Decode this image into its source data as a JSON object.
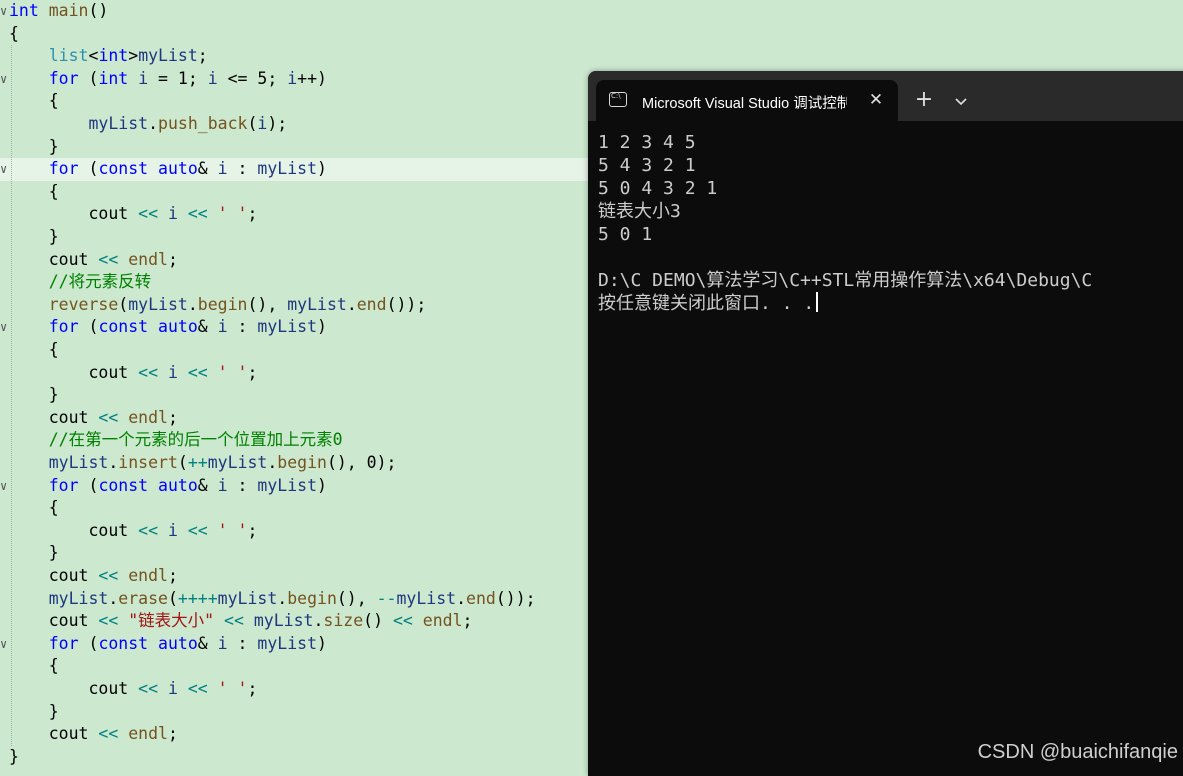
{
  "editor": {
    "lines": [
      {
        "fold": true,
        "hl": false,
        "tokens": [
          [
            "k",
            "int"
          ],
          [
            "p",
            " "
          ],
          [
            "f",
            "main"
          ],
          [
            "p",
            "()"
          ]
        ]
      },
      {
        "fold": false,
        "hl": false,
        "tokens": [
          [
            "p",
            "{"
          ]
        ]
      },
      {
        "fold": false,
        "hl": false,
        "tokens": [
          [
            "p",
            "    "
          ],
          [
            "t",
            "list"
          ],
          [
            "p",
            "<"
          ],
          [
            "k",
            "int"
          ],
          [
            "p",
            ">"
          ],
          [
            "v",
            "myList"
          ],
          [
            "p",
            ";"
          ]
        ]
      },
      {
        "fold": true,
        "hl": false,
        "tokens": [
          [
            "p",
            "    "
          ],
          [
            "k",
            "for"
          ],
          [
            "p",
            " ("
          ],
          [
            "k",
            "int"
          ],
          [
            "p",
            " "
          ],
          [
            "v",
            "i"
          ],
          [
            "p",
            " = 1; "
          ],
          [
            "v",
            "i"
          ],
          [
            "p",
            " <= 5; "
          ],
          [
            "v",
            "i"
          ],
          [
            "p",
            "++)"
          ]
        ]
      },
      {
        "fold": false,
        "hl": false,
        "tokens": [
          [
            "p",
            "    {"
          ]
        ]
      },
      {
        "fold": false,
        "hl": false,
        "tokens": [
          [
            "p",
            "        "
          ],
          [
            "v",
            "myList"
          ],
          [
            "p",
            "."
          ],
          [
            "f",
            "push_back"
          ],
          [
            "p",
            "("
          ],
          [
            "v",
            "i"
          ],
          [
            "p",
            ");"
          ]
        ]
      },
      {
        "fold": false,
        "hl": false,
        "tokens": [
          [
            "p",
            "    }"
          ]
        ]
      },
      {
        "fold": true,
        "hl": true,
        "tokens": [
          [
            "p",
            "    "
          ],
          [
            "k",
            "for"
          ],
          [
            "p",
            " ("
          ],
          [
            "k",
            "const"
          ],
          [
            "p",
            " "
          ],
          [
            "k",
            "auto"
          ],
          [
            "p",
            "& "
          ],
          [
            "v",
            "i"
          ],
          [
            "p",
            " : "
          ],
          [
            "v",
            "myList"
          ],
          [
            "p",
            ")"
          ]
        ]
      },
      {
        "fold": false,
        "hl": false,
        "tokens": [
          [
            "p",
            "    {"
          ]
        ]
      },
      {
        "fold": false,
        "hl": false,
        "tokens": [
          [
            "p",
            "        cout "
          ],
          [
            "o",
            "<<"
          ],
          [
            "p",
            " "
          ],
          [
            "v",
            "i"
          ],
          [
            "p",
            " "
          ],
          [
            "o",
            "<<"
          ],
          [
            "p",
            " "
          ],
          [
            "s",
            "' '"
          ],
          [
            "p",
            ";"
          ]
        ]
      },
      {
        "fold": false,
        "hl": false,
        "tokens": [
          [
            "p",
            "    }"
          ]
        ]
      },
      {
        "fold": false,
        "hl": false,
        "tokens": [
          [
            "p",
            "    cout "
          ],
          [
            "o",
            "<<"
          ],
          [
            "p",
            " "
          ],
          [
            "f",
            "endl"
          ],
          [
            "p",
            ";"
          ]
        ]
      },
      {
        "fold": false,
        "hl": false,
        "tokens": [
          [
            "p",
            "    "
          ],
          [
            "c",
            "//将元素反转"
          ]
        ]
      },
      {
        "fold": false,
        "hl": false,
        "tokens": [
          [
            "p",
            "    "
          ],
          [
            "f",
            "reverse"
          ],
          [
            "p",
            "("
          ],
          [
            "v",
            "myList"
          ],
          [
            "p",
            "."
          ],
          [
            "f",
            "begin"
          ],
          [
            "p",
            "(), "
          ],
          [
            "v",
            "myList"
          ],
          [
            "p",
            "."
          ],
          [
            "f",
            "end"
          ],
          [
            "p",
            "());"
          ]
        ]
      },
      {
        "fold": true,
        "hl": false,
        "tokens": [
          [
            "p",
            "    "
          ],
          [
            "k",
            "for"
          ],
          [
            "p",
            " ("
          ],
          [
            "k",
            "const"
          ],
          [
            "p",
            " "
          ],
          [
            "k",
            "auto"
          ],
          [
            "p",
            "& "
          ],
          [
            "v",
            "i"
          ],
          [
            "p",
            " : "
          ],
          [
            "v",
            "myList"
          ],
          [
            "p",
            ")"
          ]
        ]
      },
      {
        "fold": false,
        "hl": false,
        "tokens": [
          [
            "p",
            "    {"
          ]
        ]
      },
      {
        "fold": false,
        "hl": false,
        "tokens": [
          [
            "p",
            "        cout "
          ],
          [
            "o",
            "<<"
          ],
          [
            "p",
            " "
          ],
          [
            "v",
            "i"
          ],
          [
            "p",
            " "
          ],
          [
            "o",
            "<<"
          ],
          [
            "p",
            " "
          ],
          [
            "s",
            "' '"
          ],
          [
            "p",
            ";"
          ]
        ]
      },
      {
        "fold": false,
        "hl": false,
        "tokens": [
          [
            "p",
            "    }"
          ]
        ]
      },
      {
        "fold": false,
        "hl": false,
        "tokens": [
          [
            "p",
            "    cout "
          ],
          [
            "o",
            "<<"
          ],
          [
            "p",
            " "
          ],
          [
            "f",
            "endl"
          ],
          [
            "p",
            ";"
          ]
        ]
      },
      {
        "fold": false,
        "hl": false,
        "tokens": [
          [
            "p",
            "    "
          ],
          [
            "c",
            "//在第一个元素的后一个位置加上元素0"
          ]
        ]
      },
      {
        "fold": false,
        "hl": false,
        "tokens": [
          [
            "p",
            "    "
          ],
          [
            "v",
            "myList"
          ],
          [
            "p",
            "."
          ],
          [
            "f",
            "insert"
          ],
          [
            "p",
            "("
          ],
          [
            "o",
            "++"
          ],
          [
            "v",
            "myList"
          ],
          [
            "p",
            "."
          ],
          [
            "f",
            "begin"
          ],
          [
            "p",
            "(), 0);"
          ]
        ]
      },
      {
        "fold": true,
        "hl": false,
        "tokens": [
          [
            "p",
            "    "
          ],
          [
            "k",
            "for"
          ],
          [
            "p",
            " ("
          ],
          [
            "k",
            "const"
          ],
          [
            "p",
            " "
          ],
          [
            "k",
            "auto"
          ],
          [
            "p",
            "& "
          ],
          [
            "v",
            "i"
          ],
          [
            "p",
            " : "
          ],
          [
            "v",
            "myList"
          ],
          [
            "p",
            ")"
          ]
        ]
      },
      {
        "fold": false,
        "hl": false,
        "tokens": [
          [
            "p",
            "    {"
          ]
        ]
      },
      {
        "fold": false,
        "hl": false,
        "tokens": [
          [
            "p",
            "        cout "
          ],
          [
            "o",
            "<<"
          ],
          [
            "p",
            " "
          ],
          [
            "v",
            "i"
          ],
          [
            "p",
            " "
          ],
          [
            "o",
            "<<"
          ],
          [
            "p",
            " "
          ],
          [
            "s",
            "' '"
          ],
          [
            "p",
            ";"
          ]
        ]
      },
      {
        "fold": false,
        "hl": false,
        "tokens": [
          [
            "p",
            "    }"
          ]
        ]
      },
      {
        "fold": false,
        "hl": false,
        "tokens": [
          [
            "p",
            "    cout "
          ],
          [
            "o",
            "<<"
          ],
          [
            "p",
            " "
          ],
          [
            "f",
            "endl"
          ],
          [
            "p",
            ";"
          ]
        ]
      },
      {
        "fold": false,
        "hl": false,
        "tokens": [
          [
            "p",
            "    "
          ],
          [
            "v",
            "myList"
          ],
          [
            "p",
            "."
          ],
          [
            "f",
            "erase"
          ],
          [
            "p",
            "("
          ],
          [
            "o",
            "++++"
          ],
          [
            "v",
            "myList"
          ],
          [
            "p",
            "."
          ],
          [
            "f",
            "begin"
          ],
          [
            "p",
            "(), "
          ],
          [
            "o",
            "--"
          ],
          [
            "v",
            "myList"
          ],
          [
            "p",
            "."
          ],
          [
            "f",
            "end"
          ],
          [
            "p",
            "());"
          ]
        ]
      },
      {
        "fold": false,
        "hl": false,
        "tokens": [
          [
            "p",
            "    cout "
          ],
          [
            "o",
            "<<"
          ],
          [
            "p",
            " "
          ],
          [
            "s",
            "\"链表大小\""
          ],
          [
            "p",
            " "
          ],
          [
            "o",
            "<<"
          ],
          [
            "p",
            " "
          ],
          [
            "v",
            "myList"
          ],
          [
            "p",
            "."
          ],
          [
            "f",
            "size"
          ],
          [
            "p",
            "() "
          ],
          [
            "o",
            "<<"
          ],
          [
            "p",
            " "
          ],
          [
            "f",
            "endl"
          ],
          [
            "p",
            ";"
          ]
        ]
      },
      {
        "fold": true,
        "hl": false,
        "tokens": [
          [
            "p",
            "    "
          ],
          [
            "k",
            "for"
          ],
          [
            "p",
            " ("
          ],
          [
            "k",
            "const"
          ],
          [
            "p",
            " "
          ],
          [
            "k",
            "auto"
          ],
          [
            "p",
            "& "
          ],
          [
            "v",
            "i"
          ],
          [
            "p",
            " : "
          ],
          [
            "v",
            "myList"
          ],
          [
            "p",
            ")"
          ]
        ]
      },
      {
        "fold": false,
        "hl": false,
        "tokens": [
          [
            "p",
            "    {"
          ]
        ]
      },
      {
        "fold": false,
        "hl": false,
        "tokens": [
          [
            "p",
            "        cout "
          ],
          [
            "o",
            "<<"
          ],
          [
            "p",
            " "
          ],
          [
            "v",
            "i"
          ],
          [
            "p",
            " "
          ],
          [
            "o",
            "<<"
          ],
          [
            "p",
            " "
          ],
          [
            "s",
            "' '"
          ],
          [
            "p",
            ";"
          ]
        ]
      },
      {
        "fold": false,
        "hl": false,
        "tokens": [
          [
            "p",
            "    }"
          ]
        ]
      },
      {
        "fold": false,
        "hl": false,
        "tokens": [
          [
            "p",
            "    cout "
          ],
          [
            "o",
            "<<"
          ],
          [
            "p",
            " "
          ],
          [
            "f",
            "endl"
          ],
          [
            "p",
            ";"
          ]
        ]
      },
      {
        "fold": false,
        "hl": false,
        "tokens": [
          [
            "p",
            "}"
          ]
        ]
      }
    ]
  },
  "terminal": {
    "tab_title": "Microsoft Visual Studio 调试控制台",
    "tab_icon": "console-icon",
    "close_glyph": "✕",
    "new_tab_glyph": "+",
    "output": [
      "1 2 3 4 5",
      "5 4 3 2 1",
      "5 0 4 3 2 1",
      "链表大小3",
      "5 0 1",
      "",
      "D:\\C DEMO\\算法学习\\C++STL常用操作算法\\x64\\Debug\\C",
      "按任意键关闭此窗口. . ."
    ]
  },
  "watermark": "CSDN @buaichifanqie"
}
